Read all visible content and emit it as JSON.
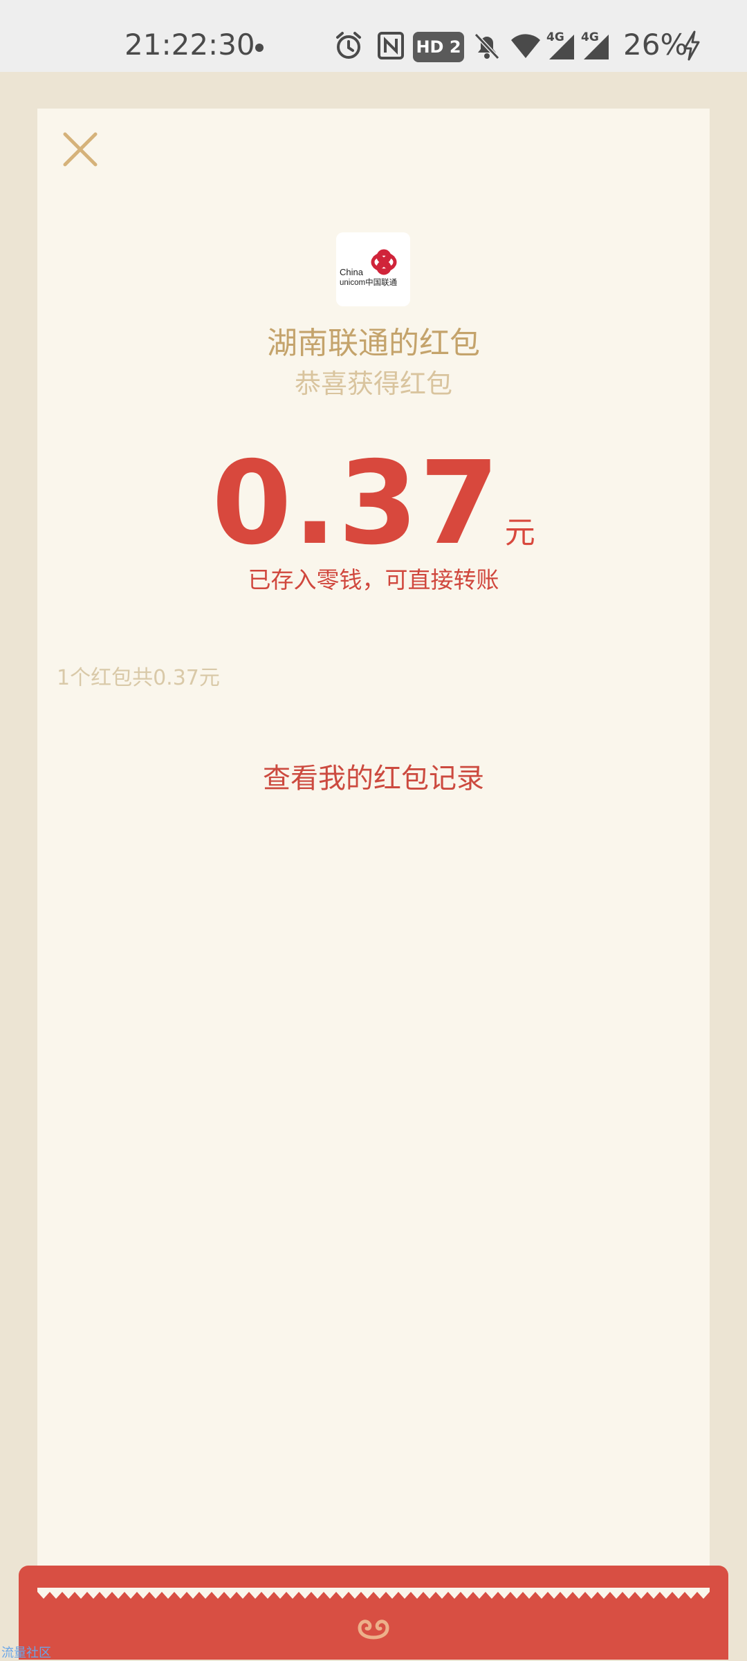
{
  "status_bar": {
    "time": "21:22:30",
    "hd_label": "HD 2",
    "network_labels": [
      "4G",
      "4G"
    ],
    "battery": "26%",
    "icons": [
      "dot-icon",
      "alarm-icon",
      "nfc-icon",
      "hd-icon",
      "mute-icon",
      "wifi-icon",
      "signal-icon",
      "signal-icon",
      "charging-icon"
    ]
  },
  "card": {
    "close_icon": "close-icon",
    "logo": {
      "text_line1": "China",
      "text_line2": "unicom中国联通",
      "brand_color": "#D0243A"
    },
    "sender_title": "湖南联通的红包",
    "sender_subtitle": "恭喜获得红包",
    "amount": "0.37",
    "amount_unit": "元",
    "amount_note": "已存入零钱，可直接转账",
    "summary": "1个红包共0.37元",
    "records_link": "查看我的红包记录"
  },
  "footer": {
    "icon": "cloud-icon",
    "watermark": "流量社区"
  },
  "colors": {
    "background": "#ECE4D3",
    "card": "#FAF6EC",
    "accent_red": "#D8483D",
    "gold": "#C4A36B"
  }
}
